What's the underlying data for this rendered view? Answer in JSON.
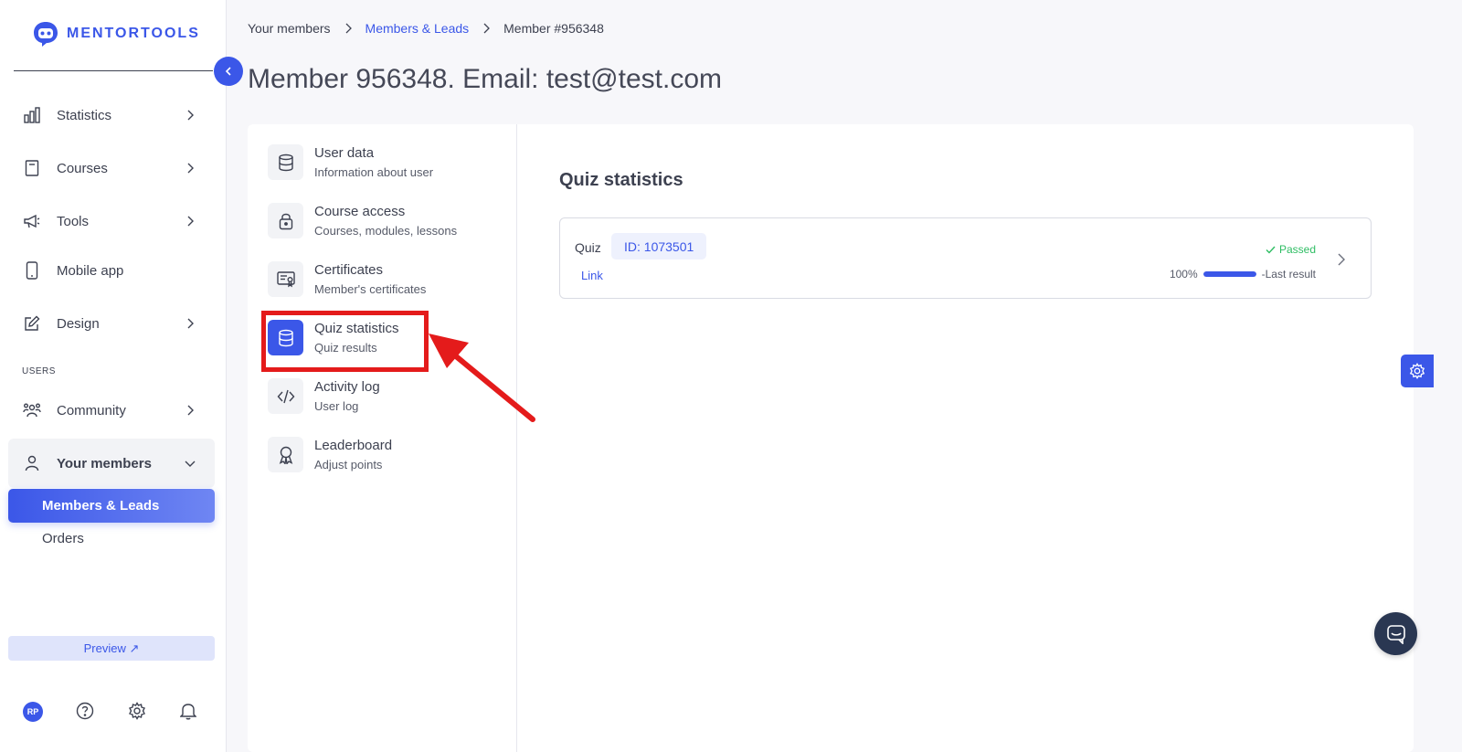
{
  "brand": {
    "name": "MENTORTOOLS"
  },
  "sidebar": {
    "items": [
      {
        "label": "Statistics",
        "icon": "bar-chart-icon"
      },
      {
        "label": "Courses",
        "icon": "book-icon"
      },
      {
        "label": "Tools",
        "icon": "megaphone-icon"
      },
      {
        "label": "Mobile app",
        "icon": "phone-icon"
      },
      {
        "label": "Design",
        "icon": "pencil-icon"
      }
    ],
    "section_users": "USERS",
    "community": "Community",
    "your_members": "Your members",
    "sub_items": [
      "Members & Leads",
      "Orders"
    ],
    "preview": "Preview ↗",
    "avatar_initials": "RP"
  },
  "breadcrumb": {
    "items": [
      "Your members",
      "Members & Leads",
      "Member #956348"
    ]
  },
  "page": {
    "title": "Member 956348. Email: test@test.com"
  },
  "member_menu": [
    {
      "title": "User data",
      "subtitle": "Information about user",
      "icon": "database-icon"
    },
    {
      "title": "Course access",
      "subtitle": "Courses, modules, lessons",
      "icon": "lock-icon"
    },
    {
      "title": "Certificates",
      "subtitle": "Member's certificates",
      "icon": "certificate-icon"
    },
    {
      "title": "Quiz statistics",
      "subtitle": "Quiz results",
      "icon": "database-icon",
      "active": true
    },
    {
      "title": "Activity log",
      "subtitle": "User log",
      "icon": "code-icon"
    },
    {
      "title": "Leaderboard",
      "subtitle": "Adjust points",
      "icon": "award-icon"
    }
  ],
  "quiz_section": {
    "title": "Quiz statistics",
    "rows": [
      {
        "label": "Quiz",
        "id": "ID: 1073501",
        "link": "Link",
        "status": "Passed",
        "percent_text": "100%",
        "progress": 1.0,
        "result_label": "-Last result"
      }
    ]
  },
  "colors": {
    "accent": "#3b57e8",
    "success": "#2ebd63",
    "annotation": "#e41b1b"
  }
}
